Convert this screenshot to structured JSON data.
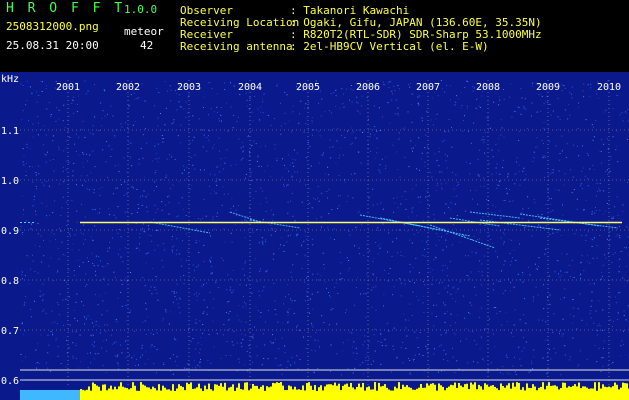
{
  "app": {
    "name": "H R O F F T",
    "version": "1.0.0"
  },
  "file": {
    "name": "2508312000.png",
    "timestamp": "25.08.31 20:00"
  },
  "meteor": {
    "label": "meteor",
    "count": "42"
  },
  "info": [
    {
      "key": "Observer",
      "value": ": Takanori Kawachi"
    },
    {
      "key": "Receiving Location",
      "value": ": Ogaki, Gifu, JAPAN (136.60E, 35.35N)"
    },
    {
      "key": "Receiver",
      "value": ": R820T2(RTL-SDR) SDR-Sharp 53.1000MHz"
    },
    {
      "key": "Receiving antenna",
      "value": ": 2el-HB9CV Vertical (el. E-W)"
    }
  ],
  "spectrogram": {
    "y_unit": "kHz",
    "y_ticks": [
      "1.1",
      "1.0",
      "0.9",
      "0.8",
      "0.7",
      "0.6"
    ],
    "x_ticks": [
      "2001",
      "2002",
      "2003",
      "2004",
      "2005",
      "2006",
      "2007",
      "2008",
      "2009",
      "2010"
    ],
    "carrier_khz": 0.915,
    "colors": {
      "bg": "#0a1a8c",
      "grid": "#c8c8c8",
      "carrier": "#ffff60",
      "noise_floor": "#ffff00",
      "meteor": "#50d0ff"
    }
  }
}
